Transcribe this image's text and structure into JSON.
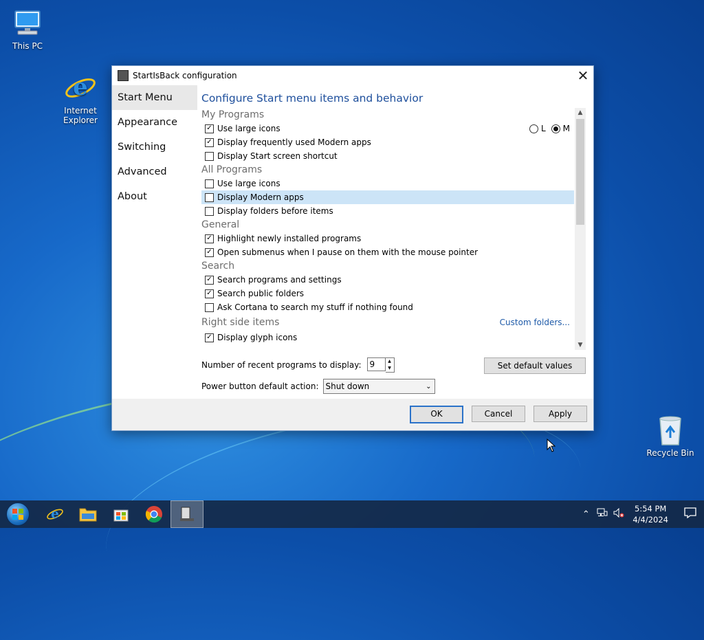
{
  "desktop": {
    "icons": {
      "this_pc": "This PC",
      "internet_explorer": "Internet Explorer",
      "recycle_bin": "Recycle Bin"
    }
  },
  "dialog": {
    "title": "StartIsBack configuration",
    "nav": [
      "Start Menu",
      "Appearance",
      "Switching",
      "Advanced",
      "About"
    ],
    "active_nav": "Start Menu",
    "heading": "Configure Start menu items and behavior",
    "sections": {
      "my_programs": {
        "title": "My Programs",
        "use_large_icons": {
          "label": "Use large icons",
          "checked": true
        },
        "display_frequent_modern": {
          "label": "Display frequently used Modern apps",
          "checked": true
        },
        "display_start_screen": {
          "label": "Display Start screen shortcut",
          "checked": false
        },
        "size_options": {
          "l": "L",
          "m": "M",
          "selected": "M"
        }
      },
      "all_programs": {
        "title": "All Programs",
        "use_large_icons": {
          "label": "Use large icons",
          "checked": false
        },
        "display_modern_apps": {
          "label": "Display Modern apps",
          "checked": false
        },
        "display_folders_before": {
          "label": "Display folders before items",
          "checked": false
        }
      },
      "general": {
        "title": "General",
        "highlight_new": {
          "label": "Highlight newly installed programs",
          "checked": true
        },
        "open_submenus": {
          "label": "Open submenus when I pause on them with the mouse pointer",
          "checked": true
        }
      },
      "search": {
        "title": "Search",
        "search_programs": {
          "label": "Search programs and settings",
          "checked": true
        },
        "search_public": {
          "label": "Search public folders",
          "checked": true
        },
        "ask_cortana": {
          "label": "Ask Cortana to search my stuff if nothing found",
          "checked": false
        }
      },
      "right_side": {
        "title": "Right side items",
        "custom_folders": "Custom folders...",
        "display_glyph": {
          "label": "Display glyph icons",
          "checked": true
        }
      }
    },
    "recent_programs_label": "Number of recent programs to display:",
    "recent_programs_value": "9",
    "set_defaults": "Set default values",
    "power_label": "Power button default action:",
    "power_value": "Shut down",
    "ok": "OK",
    "cancel": "Cancel",
    "apply": "Apply"
  },
  "taskbar": {
    "time": "5:54 PM",
    "date": "4/4/2024"
  }
}
